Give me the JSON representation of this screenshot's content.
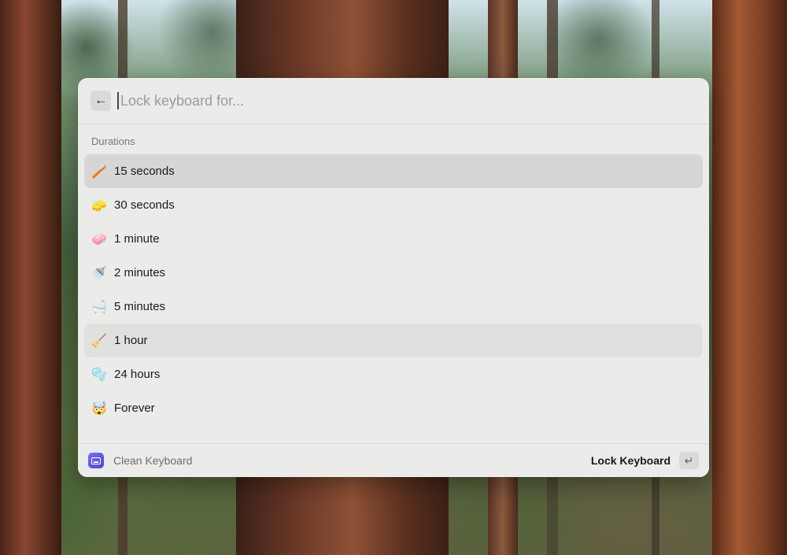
{
  "search": {
    "back_icon": "arrow-left-icon",
    "placeholder": "Lock keyboard for..."
  },
  "section": {
    "title": "Durations"
  },
  "items": [
    {
      "emoji": "🪥",
      "icon": "toothbrush-icon",
      "label": "15 seconds",
      "state": "selected"
    },
    {
      "emoji": "🧽",
      "icon": "sponge-icon",
      "label": "30 seconds",
      "state": ""
    },
    {
      "emoji": "🧼",
      "icon": "soap-icon",
      "label": "1 minute",
      "state": ""
    },
    {
      "emoji": "🚿",
      "icon": "shower-icon",
      "label": "2 minutes",
      "state": ""
    },
    {
      "emoji": "🛁",
      "icon": "bathtub-icon",
      "label": "5 minutes",
      "state": ""
    },
    {
      "emoji": "🧹",
      "icon": "broom-icon",
      "label": "1 hour",
      "state": "hover"
    },
    {
      "emoji": "🫧",
      "icon": "bubbles-icon",
      "label": "24 hours",
      "state": ""
    },
    {
      "emoji": "🤯",
      "icon": "exploding-head-icon",
      "label": "Forever",
      "state": ""
    }
  ],
  "footer": {
    "app_icon": "keyboard-app-icon",
    "app_name": "Clean Keyboard",
    "action_label": "Lock Keyboard",
    "enter_key_glyph": "↵"
  }
}
